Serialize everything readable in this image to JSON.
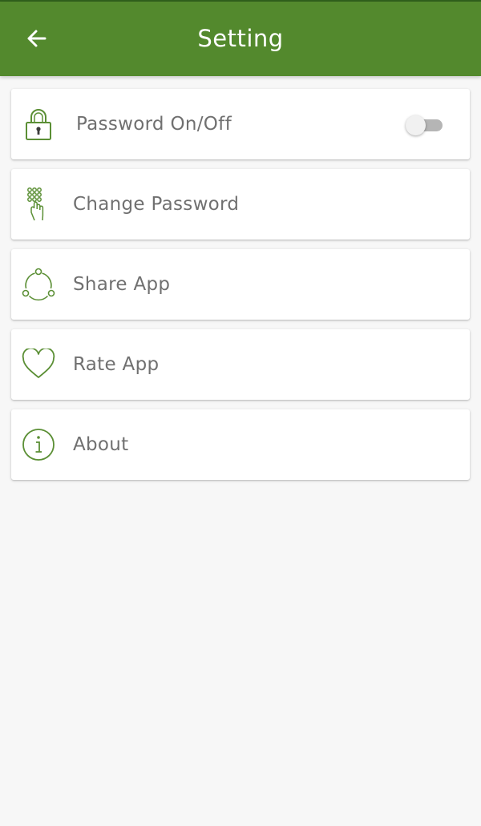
{
  "app_bar": {
    "title": "Setting",
    "back_icon": "arrow-left-icon"
  },
  "settings": [
    {
      "label": "Password On/Off",
      "icon": "padlock-icon",
      "toggle": false
    },
    {
      "label": "Change Password",
      "icon": "keypad-touch-icon"
    },
    {
      "label": "Share App",
      "icon": "share-icon"
    },
    {
      "label": "Rate App",
      "icon": "heart-icon"
    },
    {
      "label": "About",
      "icon": "info-icon"
    }
  ],
  "colors": {
    "primary": "#53892d",
    "icon_green": "#5b8f35",
    "text": "#707070",
    "background": "#f7f7f7"
  }
}
